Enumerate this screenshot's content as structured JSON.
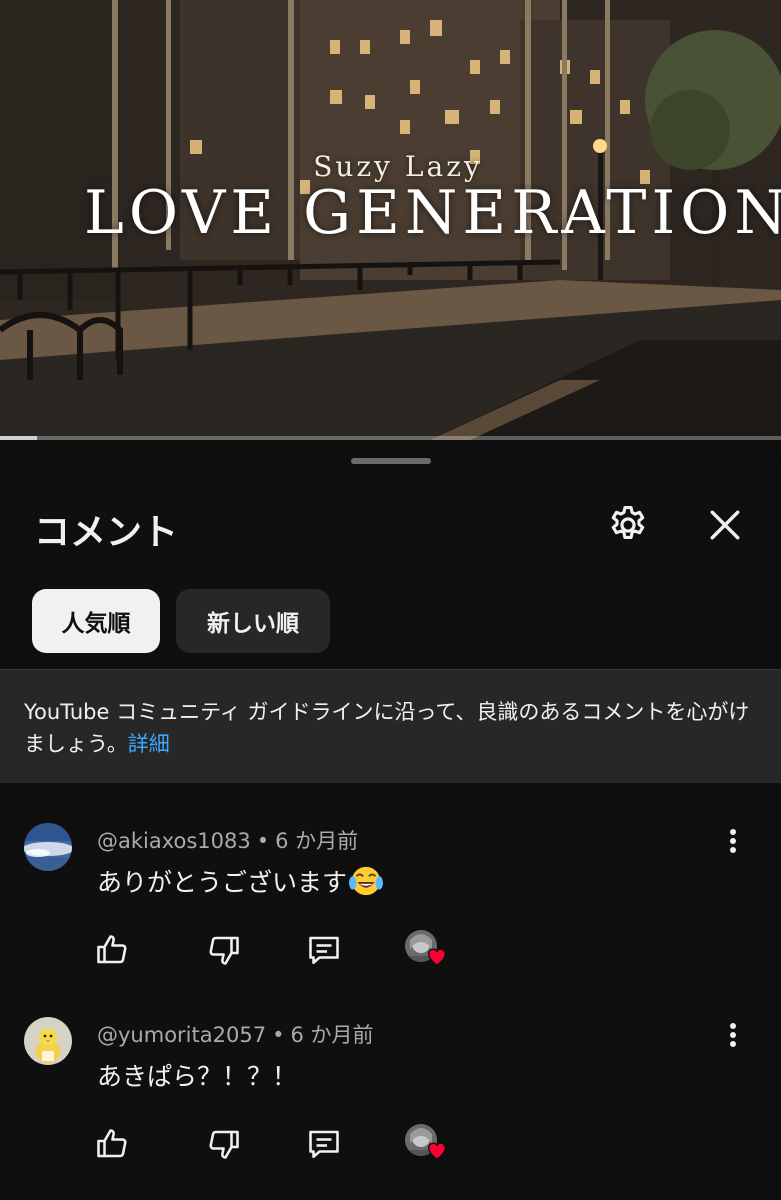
{
  "video": {
    "artist": "Suzy Lazy",
    "title": "LOVE GENERATION",
    "progress": 0.048
  },
  "comments_panel": {
    "title": "コメント",
    "settings_icon": "gear-icon",
    "close_icon": "close-icon",
    "sort_chips": [
      {
        "label": "人気順",
        "selected": true
      },
      {
        "label": "新しい順",
        "selected": false
      }
    ],
    "guideline": {
      "text": "YouTube コミュニティ ガイドラインに沿って、良識のあるコメントを心がけましょう。",
      "link": "詳細"
    },
    "comments": [
      {
        "author": "@akiaxos1083",
        "separator": "•",
        "time": "6 か月前",
        "text": "ありがとうございます",
        "emoji": "face-with-tears-of-joy",
        "creator_hearted": true
      },
      {
        "author": "@yumorita2057",
        "separator": "•",
        "time": "6 か月前",
        "text": "あきぱら？！？！",
        "creator_hearted": true
      }
    ]
  },
  "colors": {
    "background": "#0f0f0f",
    "chip_selected": "#f1f1f1",
    "chip_unselected": "#272727",
    "link": "#3ea6ff",
    "heart": "#ff0033"
  }
}
